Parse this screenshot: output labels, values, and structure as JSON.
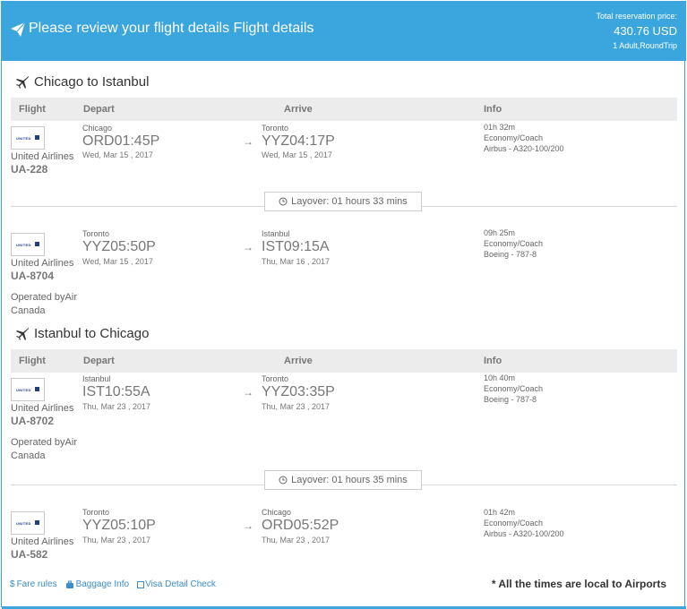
{
  "header": {
    "title": "Please review your flight details Flight details",
    "price_label": "Total reservation price:",
    "price_value": "430.76 USD",
    "price_sub": "1 Adult,RoundTrip"
  },
  "columns": {
    "flight": "Flight",
    "depart": "Depart",
    "arrive": "Arrive",
    "info": "Info"
  },
  "trips": [
    {
      "title": "Chicago to Istanbul",
      "legs": [
        {
          "airline": "United Airlines",
          "flight_no": "UA-228",
          "operated": "",
          "dep_city": "Chicago",
          "dep_code": "ORD",
          "dep_time": "01:45P",
          "dep_date": "Wed, Mar 15 , 2017",
          "arr_city": "Toronto",
          "arr_code": "YYZ",
          "arr_time": "04:17P",
          "arr_date": "Wed, Mar 15 , 2017",
          "duration": "01h 32m",
          "cabin": "Economy/Coach",
          "aircraft": "Airbus - A320-100/200"
        },
        {
          "airline": "United Airlines",
          "flight_no": "UA-8704",
          "operated": "Operated byAir Canada",
          "dep_city": "Toronto",
          "dep_code": "YYZ",
          "dep_time": "05:50P",
          "dep_date": "Wed, Mar 15 , 2017",
          "arr_city": "Istanbul",
          "arr_code": "IST",
          "arr_time": "09:15A",
          "arr_date": "Thu, Mar 16 , 2017",
          "duration": "09h 25m",
          "cabin": "Economy/Coach",
          "aircraft": "Boeing - 787-8"
        }
      ],
      "layover": "Layover: 01 hours 33 mins"
    },
    {
      "title": "Istanbul to Chicago",
      "legs": [
        {
          "airline": "United Airlines",
          "flight_no": "UA-8702",
          "operated": "Operated byAir Canada",
          "dep_city": "Istanbul",
          "dep_code": "IST",
          "dep_time": "10:55A",
          "dep_date": "Thu, Mar 23 , 2017",
          "arr_city": "Toronto",
          "arr_code": "YYZ",
          "arr_time": "03:35P",
          "arr_date": "Thu, Mar 23 , 2017",
          "duration": "10h 40m",
          "cabin": "Economy/Coach",
          "aircraft": "Boeing - 787-8"
        },
        {
          "airline": "United Airlines",
          "flight_no": "UA-582",
          "operated": "",
          "dep_city": "Toronto",
          "dep_code": "YYZ",
          "dep_time": "05:10P",
          "dep_date": "Thu, Mar 23 , 2017",
          "arr_city": "Chicago",
          "arr_code": "ORD",
          "arr_time": "05:52P",
          "arr_date": "Thu, Mar 23 , 2017",
          "duration": "01h 42m",
          "cabin": "Economy/Coach",
          "aircraft": "Airbus - A320-100/200"
        }
      ],
      "layover": "Layover: 01 hours 35 mins"
    }
  ],
  "logo_text": "UNITED",
  "footer": {
    "fare_rules": "Fare rules",
    "baggage": "Baggage Info",
    "visa": "Visa Detail Check",
    "note": "* All the times are local to Airports"
  },
  "colors": {
    "accent": "#3aa6dd",
    "link": "#3a8ccb",
    "header_row": "#ececec"
  },
  "icons": {
    "header": "paper-plane-icon",
    "trip": "airplane-icon",
    "layover": "clock-icon",
    "fare": "dollar-icon",
    "baggage": "suitcase-icon",
    "visa": "checkbox-icon"
  }
}
